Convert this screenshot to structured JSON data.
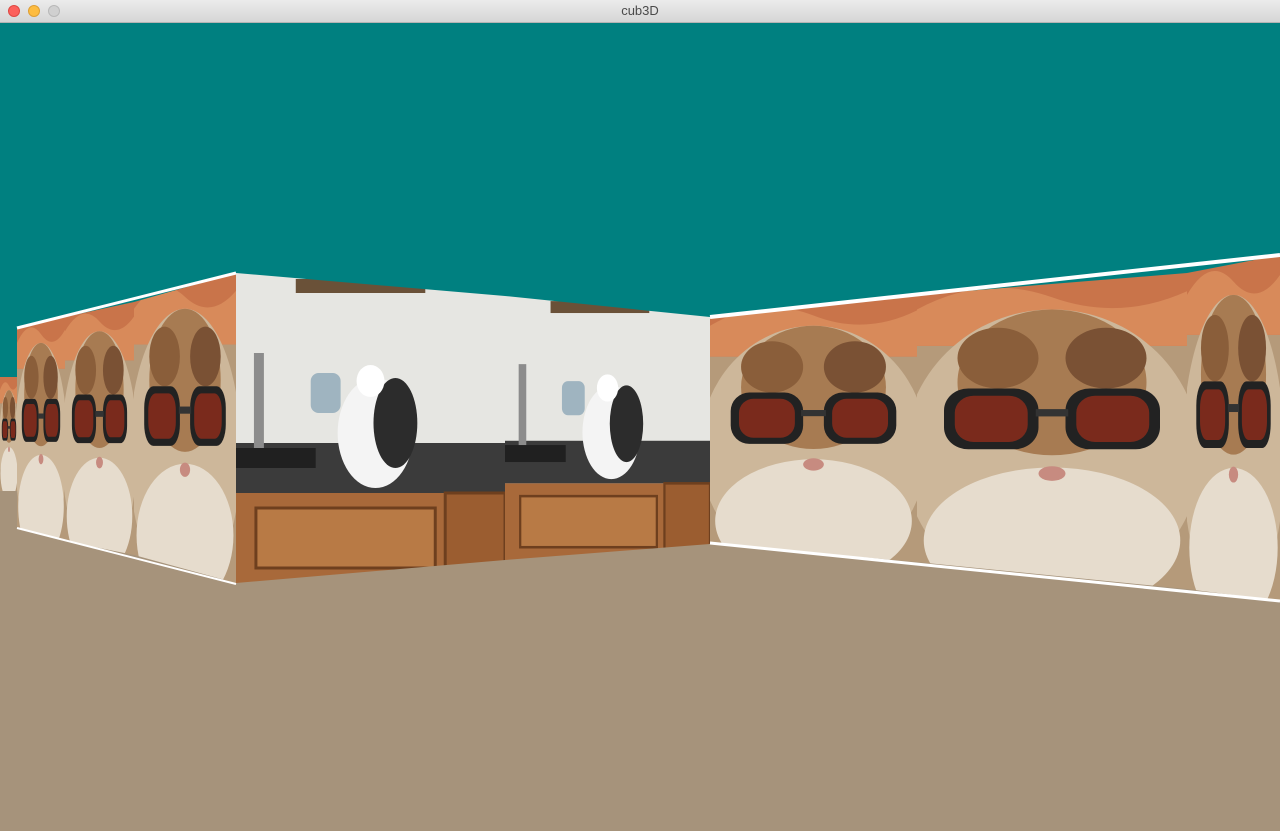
{
  "window": {
    "title": "cub3D"
  },
  "scene": {
    "ceiling_color": "#008080",
    "floor_color": "#a6937b",
    "wall_edge_color": "#ffffff",
    "textures": [
      "cat-sunglasses-texture",
      "cat-kitchen-counter-texture"
    ]
  }
}
